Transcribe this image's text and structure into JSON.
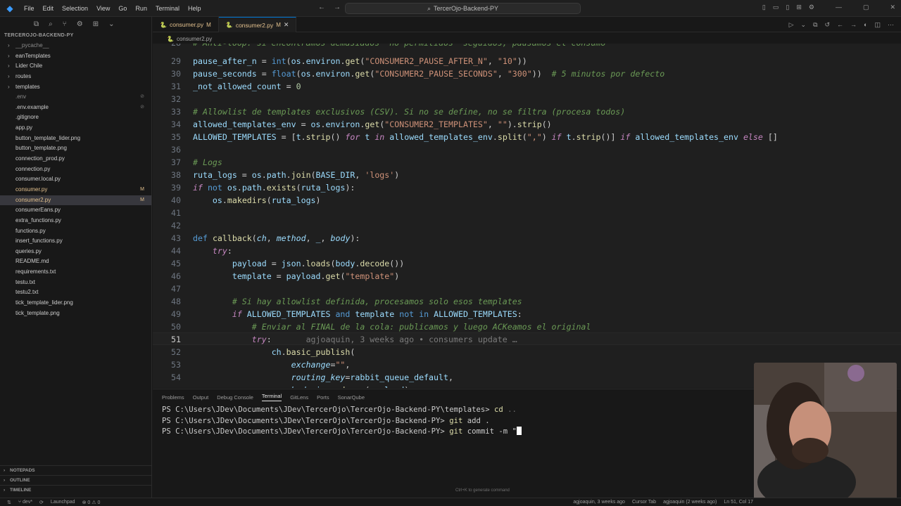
{
  "titlebar": {
    "menu": [
      "File",
      "Edit",
      "Selection",
      "View",
      "Go",
      "Run",
      "Terminal",
      "Help"
    ],
    "search": "TercerOjo-Backend-PY"
  },
  "sidebar": {
    "root": "TERCEROJO-BACKEND-PY",
    "items": [
      {
        "label": "__pycache__",
        "type": "dir",
        "state": "ign"
      },
      {
        "label": "eanTemplates",
        "type": "dir"
      },
      {
        "label": "Lider Chile",
        "type": "dir"
      },
      {
        "label": "routes",
        "type": "dir"
      },
      {
        "label": "templates",
        "type": "dir"
      },
      {
        "label": ".env",
        "state": "ign",
        "mark": "⊘"
      },
      {
        "label": ".env.example",
        "mark": "⊘"
      },
      {
        "label": ".gitignore"
      },
      {
        "label": "app.py"
      },
      {
        "label": "button_template_lider.png"
      },
      {
        "label": "button_template.png"
      },
      {
        "label": "connection_prod.py"
      },
      {
        "label": "connection.py"
      },
      {
        "label": "consumer.local.py"
      },
      {
        "label": "consumer.py",
        "state": "mod",
        "mark": "M"
      },
      {
        "label": "consumer2.py",
        "state": "active",
        "mark": "M"
      },
      {
        "label": "consumerEans.py"
      },
      {
        "label": "extra_functions.py"
      },
      {
        "label": "functions.py"
      },
      {
        "label": "insert_functions.py"
      },
      {
        "label": "queries.py"
      },
      {
        "label": "README.md"
      },
      {
        "label": "requirements.txt"
      },
      {
        "label": "testu.txt"
      },
      {
        "label": "testu2.txt"
      },
      {
        "label": "tick_template_lider.png"
      },
      {
        "label": "tick_template.png"
      }
    ],
    "panels": [
      "NOTEPADS",
      "OUTLINE",
      "TIMELINE"
    ]
  },
  "tabs": [
    {
      "label": "consumer.py",
      "flag": "M",
      "active": false
    },
    {
      "label": "consumer2.py",
      "flag": "M",
      "active": true
    }
  ],
  "breadcrumb": "consumer2.py",
  "editor": {
    "current_line": 51,
    "blame": "agjoaquin, 3 weeks ago • consumers update …",
    "line_numbers": [
      "28",
      "29",
      "30",
      "31",
      "32",
      "33",
      "34",
      "35",
      "36",
      "37",
      "38",
      "39",
      "40",
      "41",
      "42",
      "43",
      "44",
      "45",
      "46",
      "47",
      "48",
      "49",
      "50",
      "51",
      "52",
      "53",
      "54"
    ]
  },
  "panel": {
    "tabs": [
      "Problems",
      "Output",
      "Debug Console",
      "Terminal",
      "GitLens",
      "Ports",
      "SonarQube"
    ],
    "active_tab": "Terminal",
    "lines": [
      {
        "prompt": "PS C:\\Users\\JDev\\Documents\\JDev\\TercerOjo\\TercerOjo-Backend-PY\\templates> ",
        "cmd": "cd",
        "args": " .."
      },
      {
        "prompt": "PS C:\\Users\\JDev\\Documents\\JDev\\TercerOjo\\TercerOjo-Backend-PY> ",
        "cmd": "git",
        "args": " add ."
      },
      {
        "prompt": "PS C:\\Users\\JDev\\Documents\\JDev\\TercerOjo\\TercerOjo-Backend-PY> ",
        "cmd": "git",
        "args": " commit -m \""
      }
    ],
    "hint": "Ctrl+K to generate command"
  },
  "statusbar": {
    "branch": "dev*",
    "launchpad": "Launchpad",
    "problems": "⊗ 0 ⚠ 0",
    "blame": "agjoaquin, 3 weeks ago",
    "cursor_tab": "Cursor Tab",
    "author": "agjoaquin (2 weeks ago)",
    "position": "Ln 51, Col 17"
  }
}
